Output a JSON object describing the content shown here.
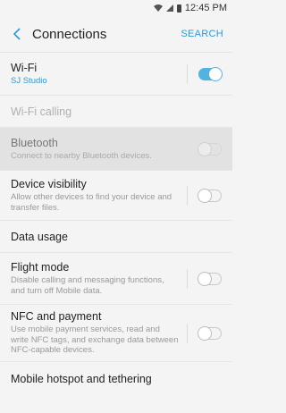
{
  "status": {
    "time": "12:45 PM"
  },
  "header": {
    "title": "Connections",
    "search_label": "SEARCH"
  },
  "items": [
    {
      "title": "Wi-Fi",
      "subtitle": "SJ Studio"
    },
    {
      "title": "Wi-Fi calling"
    },
    {
      "title": "Bluetooth",
      "subtitle": "Connect to nearby Bluetooth devices."
    },
    {
      "title": "Device visibility",
      "subtitle": "Allow other devices to find your device and transfer files."
    },
    {
      "title": "Data usage"
    },
    {
      "title": "Flight mode",
      "subtitle": "Disable calling and messaging functions, and turn off Mobile data."
    },
    {
      "title": "NFC and payment",
      "subtitle": "Use mobile payment services, read and write NFC tags, and exchange data between NFC-capable devices."
    },
    {
      "title": "Mobile hotspot and tethering"
    }
  ],
  "colors": {
    "accent": "#2b9ad7",
    "toggle_on": "#54b2e0"
  },
  "icons": {
    "back": "chevron-left-icon",
    "wifi": "wifi-icon",
    "signal": "signal-icon",
    "battery": "battery-icon"
  }
}
